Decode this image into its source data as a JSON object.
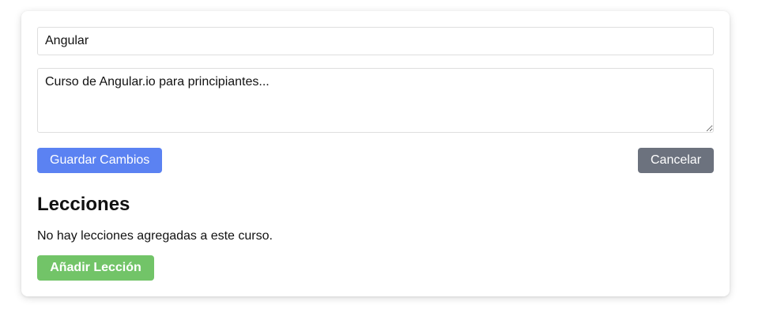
{
  "form": {
    "title_value": "Angular",
    "description_value": "Curso de Angular.io para principiantes..."
  },
  "actions": {
    "save_label": "Guardar Cambios",
    "cancel_label": "Cancelar"
  },
  "lessons": {
    "heading": "Lecciones",
    "empty_message": "No hay lecciones agregadas a este curso.",
    "add_label": "Añadir Lección"
  },
  "colors": {
    "save_button": "#5b82f2",
    "cancel_button": "#6c727e",
    "add_button": "#72c468"
  }
}
